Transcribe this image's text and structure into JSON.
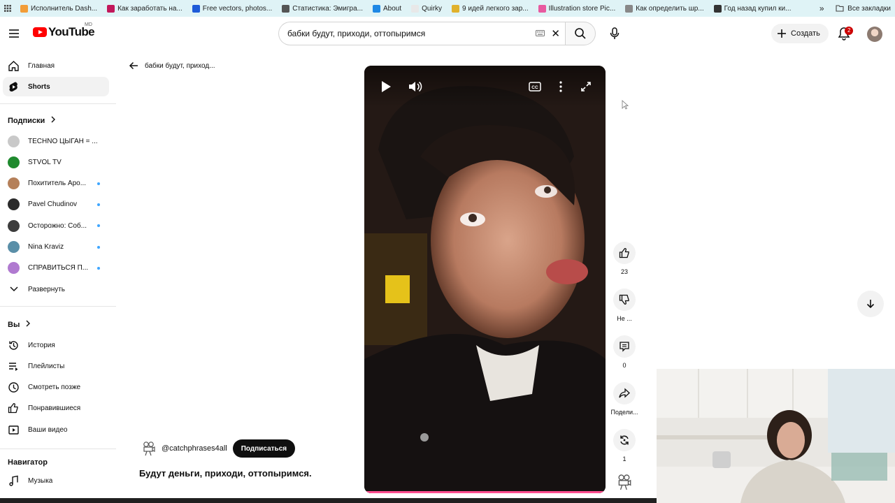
{
  "bookmarks": {
    "items": [
      {
        "label": "Исполнитель Dash...",
        "color": "#f29d38"
      },
      {
        "label": "Как заработать на...",
        "color": "#c2185b"
      },
      {
        "label": "Free vectors, photos...",
        "color": "#1e5bd8"
      },
      {
        "label": "Статистика: Эмигра...",
        "color": "#555555"
      },
      {
        "label": "About",
        "color": "#1e88e5"
      },
      {
        "label": "Quirky",
        "color": "#e8e8e8"
      },
      {
        "label": "9 идей легкого зар...",
        "color": "#e0b12c"
      },
      {
        "label": "Illustration store Pic...",
        "color": "#e85aa0"
      },
      {
        "label": "Как определить шр...",
        "color": "#888888"
      },
      {
        "label": "Год назад купил ки...",
        "color": "#333333"
      }
    ],
    "more": "»",
    "all_bookmarks": "Все закладки"
  },
  "header": {
    "logo_text": "YouTube",
    "logo_region": "MD",
    "search_value": "бабки будут, приходи, оттопыримся",
    "create_label": "Создать",
    "notifications_count": "2"
  },
  "sidebar": {
    "main": [
      {
        "label": "Главная",
        "icon": "home-icon"
      },
      {
        "label": "Shorts",
        "icon": "shorts-icon"
      }
    ],
    "subscriptions_title": "Подписки",
    "subscriptions": [
      {
        "label": "TECHNO ЦЫГАН = ...",
        "dot": false,
        "avatar": "#c9c9c9"
      },
      {
        "label": "STVOL TV",
        "dot": false,
        "avatar": "#1f8a2e"
      },
      {
        "label": "Похититель Аро...",
        "dot": true,
        "avatar": "#b5805a"
      },
      {
        "label": "Pavel Chudinov",
        "dot": true,
        "avatar": "#2b2b2b"
      },
      {
        "label": "Осторожно: Соб...",
        "dot": true,
        "avatar": "#3c3c3c"
      },
      {
        "label": "Nina Kraviz",
        "dot": true,
        "avatar": "#5a8fa8"
      },
      {
        "label": "СПРАВИТЬСЯ П...",
        "dot": true,
        "avatar": "#b07ad0"
      }
    ],
    "expand_label": "Развернуть",
    "you_title": "Вы",
    "you_items": [
      {
        "label": "История",
        "icon": "history-icon"
      },
      {
        "label": "Плейлисты",
        "icon": "playlists-icon"
      },
      {
        "label": "Смотреть позже",
        "icon": "watch-later-icon"
      },
      {
        "label": "Понравившиеся",
        "icon": "liked-icon"
      },
      {
        "label": "Ваши видео",
        "icon": "your-videos-icon"
      }
    ],
    "navigator_title": "Навигатор",
    "navigator_items": [
      {
        "label": "Музыка",
        "icon": "music-icon"
      }
    ]
  },
  "main": {
    "back_label": "бабки будут, приход...",
    "channel_handle": "@catchphrases4all",
    "subscribe_label": "Подписаться",
    "video_title": "Будут деньги, приходи, оттопыримся."
  },
  "actions": {
    "likes": "23",
    "dislike_label": "Не ...",
    "comments": "0",
    "share_label": "Подели...",
    "remix_count": "1"
  }
}
